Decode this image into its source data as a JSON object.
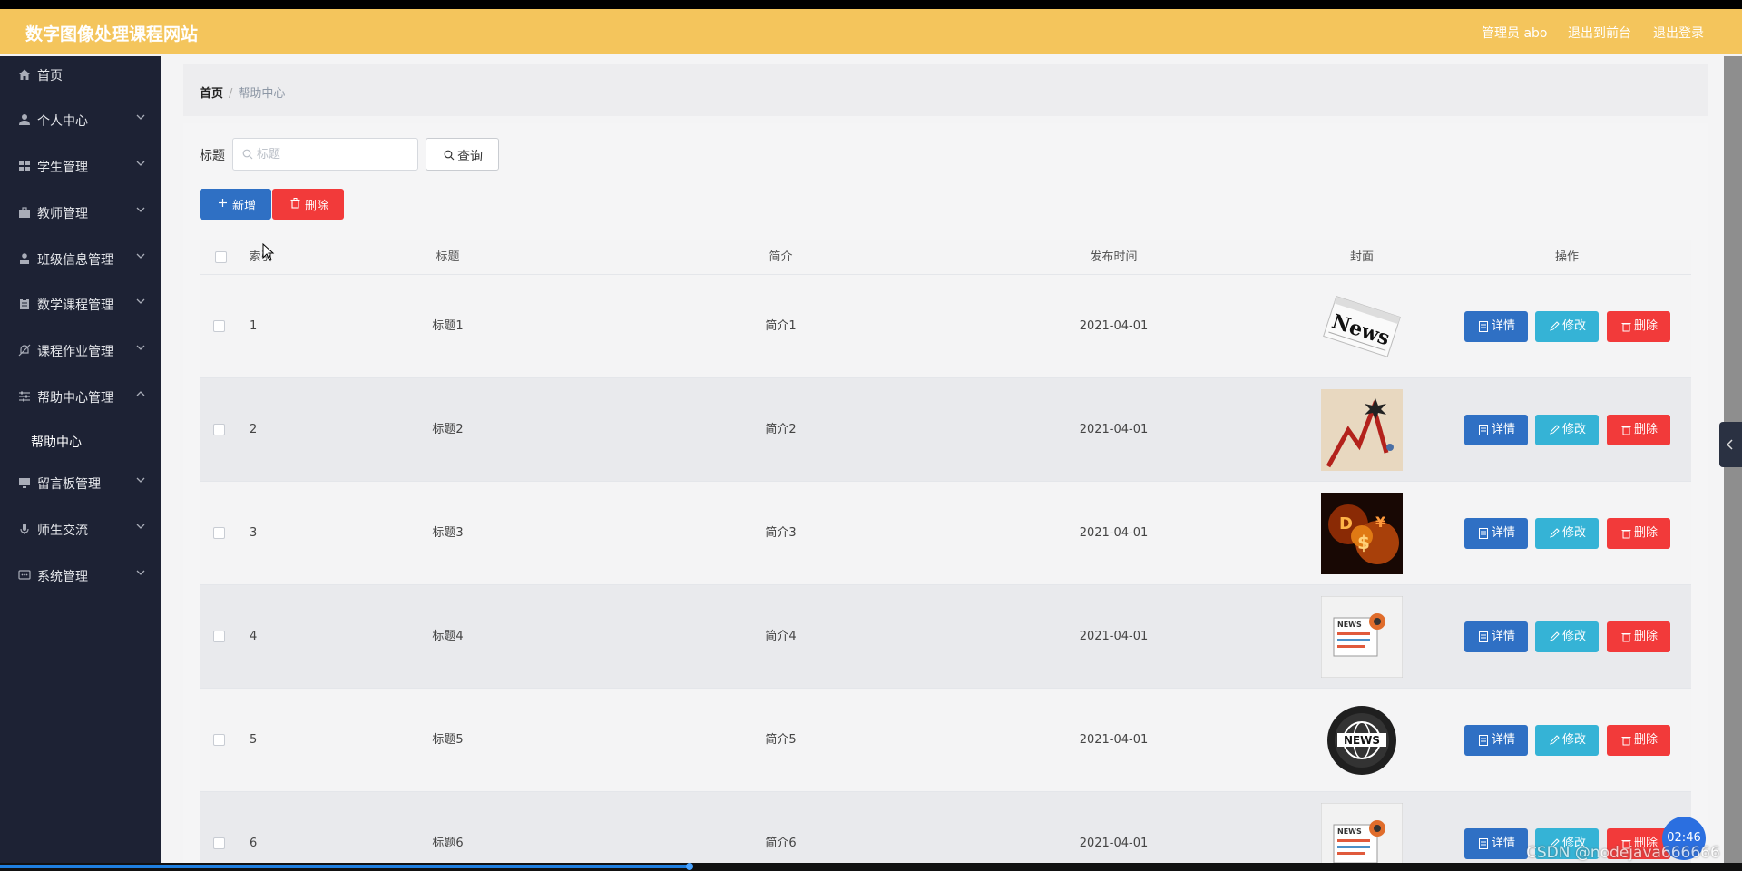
{
  "header": {
    "site_title": "数字图像处理课程网站",
    "user_label": "管理员 abo",
    "back_front_label": "退出到前台",
    "logout_label": "退出登录"
  },
  "sidebar": {
    "items": [
      {
        "label": "首页",
        "icon": "home-icon",
        "has_arrow": false
      },
      {
        "label": "个人中心",
        "icon": "user-icon",
        "has_arrow": true
      },
      {
        "label": "学生管理",
        "icon": "grid-icon",
        "has_arrow": true
      },
      {
        "label": "教师管理",
        "icon": "briefcase-icon",
        "has_arrow": true
      },
      {
        "label": "班级信息管理",
        "icon": "person-icon",
        "has_arrow": true
      },
      {
        "label": "数学课程管理",
        "icon": "clipboard-icon",
        "has_arrow": true
      },
      {
        "label": "课程作业管理",
        "icon": "bell-off-icon",
        "has_arrow": true
      },
      {
        "label": "帮助中心管理",
        "icon": "sliders-icon",
        "has_arrow": true,
        "expanded": true
      },
      {
        "label": "留言板管理",
        "icon": "monitor-icon",
        "has_arrow": true
      },
      {
        "label": "师生交流",
        "icon": "microphone-icon",
        "has_arrow": true
      },
      {
        "label": "系统管理",
        "icon": "message-icon",
        "has_arrow": true
      }
    ],
    "sub_item": "帮助中心"
  },
  "breadcrumb": {
    "home": "首页",
    "separator": "/",
    "current": "帮助中心"
  },
  "search": {
    "label": "标题",
    "placeholder": "标题",
    "value": "",
    "query_label": "查询"
  },
  "toolbar": {
    "add_label": "新增",
    "delete_label": "删除"
  },
  "table": {
    "columns": [
      "",
      "索引",
      "标题",
      "简介",
      "发布时间",
      "封面",
      "操作"
    ],
    "rows": [
      {
        "index": "1",
        "title": "标题1",
        "intro": "简介1",
        "date": "2021-04-01",
        "cover": "newspaper-news-image"
      },
      {
        "index": "2",
        "title": "标题2",
        "intro": "简介2",
        "date": "2021-04-01",
        "cover": "falling-chart-explosion-image"
      },
      {
        "index": "3",
        "title": "标题3",
        "intro": "简介3",
        "date": "2021-04-01",
        "cover": "burning-currency-image"
      },
      {
        "index": "4",
        "title": "标题4",
        "intro": "简介4",
        "date": "2021-04-01",
        "cover": "news-document-illustration-image"
      },
      {
        "index": "5",
        "title": "标题5",
        "intro": "简介5",
        "date": "2021-04-01",
        "cover": "news-globe-badge-image"
      },
      {
        "index": "6",
        "title": "标题6",
        "intro": "简介6",
        "date": "2021-04-01",
        "cover": "news-document-illustration-image"
      }
    ],
    "actions": {
      "detail": "详情",
      "edit": "修改",
      "delete": "删除"
    }
  },
  "overlay": {
    "watermark": "CSDN @nodejava666666",
    "timer": "02:46"
  },
  "colors": {
    "header": "#f4c55c",
    "sidebar": "#1d2234",
    "primary": "#2f70c4",
    "info": "#35b3d6",
    "danger": "#f23a3a"
  }
}
